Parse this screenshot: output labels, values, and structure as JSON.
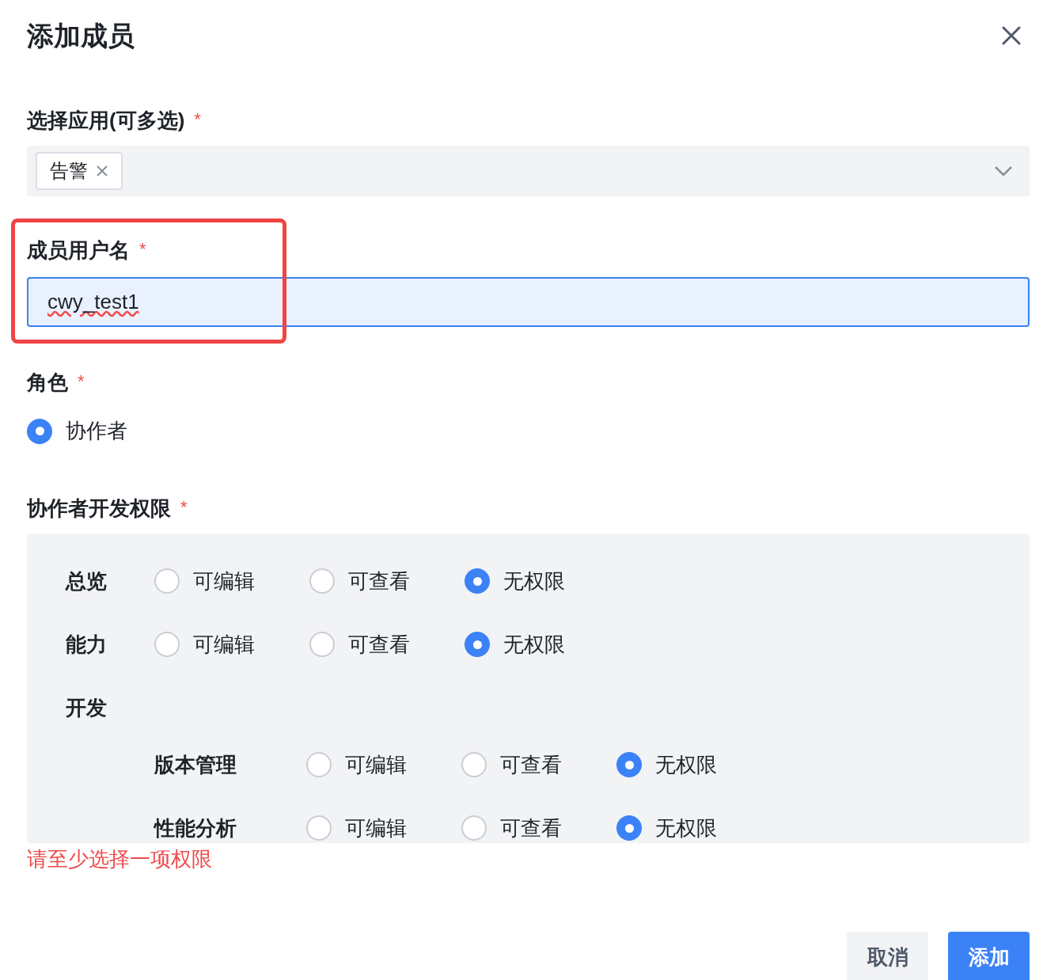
{
  "dialog": {
    "title": "添加成员"
  },
  "app_select": {
    "label": "选择应用(可多选)",
    "required": "*",
    "tags": [
      "告警"
    ]
  },
  "username": {
    "label": "成员用户名",
    "required": "*",
    "value": "cwy_test1",
    "highlighted": true
  },
  "role": {
    "label": "角色",
    "required": "*",
    "options": [
      {
        "label": "协作者",
        "selected": true
      }
    ]
  },
  "permissions": {
    "label": "协作者开发权限",
    "required": "*",
    "rows": [
      {
        "label": "总览",
        "options": [
          {
            "label": "可编辑",
            "selected": false
          },
          {
            "label": "可查看",
            "selected": false
          },
          {
            "label": "无权限",
            "selected": true
          }
        ]
      },
      {
        "label": "能力",
        "options": [
          {
            "label": "可编辑",
            "selected": false
          },
          {
            "label": "可查看",
            "selected": false
          },
          {
            "label": "无权限",
            "selected": true
          }
        ]
      },
      {
        "label": "开发",
        "children": [
          {
            "label": "版本管理",
            "options": [
              {
                "label": "可编辑",
                "selected": false
              },
              {
                "label": "可查看",
                "selected": false
              },
              {
                "label": "无权限",
                "selected": true
              }
            ]
          },
          {
            "label": "性能分析",
            "options": [
              {
                "label": "可编辑",
                "selected": false
              },
              {
                "label": "可查看",
                "selected": false
              },
              {
                "label": "无权限",
                "selected": true
              }
            ]
          }
        ]
      }
    ],
    "error": "请至少选择一项权限"
  },
  "buttons": [
    {
      "label": "取消",
      "kind": "secondary"
    },
    {
      "label": "添加",
      "kind": "primary"
    }
  ]
}
